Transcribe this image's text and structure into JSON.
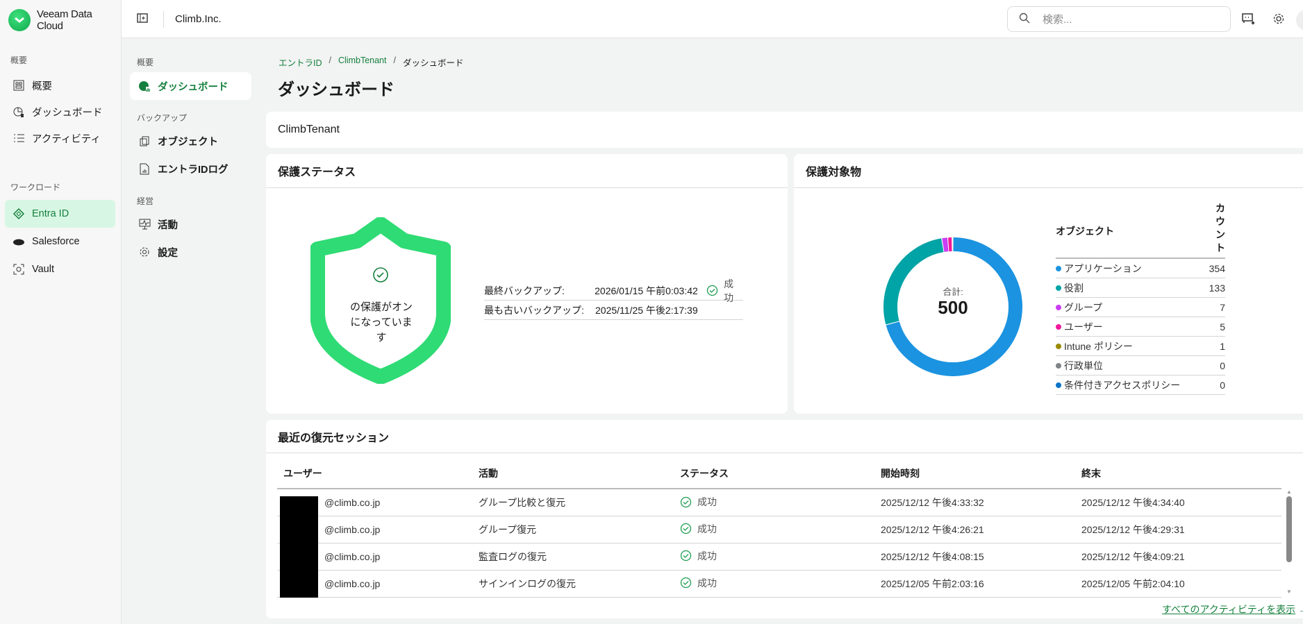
{
  "app": {
    "name": "Veeam Data Cloud",
    "org": "Climb.Inc."
  },
  "search": {
    "placeholder": "検索..."
  },
  "sidebar": {
    "section1": "概要",
    "items1": [
      {
        "label": "概要"
      },
      {
        "label": "ダッシュボード"
      },
      {
        "label": "アクティビティ"
      }
    ],
    "section2": "ワークロード",
    "items2": [
      {
        "label": "Entra ID"
      },
      {
        "label": "Salesforce"
      },
      {
        "label": "Vault"
      }
    ]
  },
  "subnav": {
    "s1": "概要",
    "dashboard": "ダッシュボード",
    "s2": "バックアップ",
    "objects": "オブジェクト",
    "entralog": "エントラIDログ",
    "s3": "経営",
    "activity": "活動",
    "settings": "設定"
  },
  "breadcrumb": [
    "エントラID",
    "ClimbTenant",
    "ダッシュボード"
  ],
  "page_title": "ダッシュボード",
  "tenant": "ClimbTenant",
  "protection": {
    "title": "保護ステータス",
    "shield_text": "の保護がオンになっています",
    "last_label": "最終バックアップ:",
    "last_value": "2026/01/15 午前0:03:42",
    "last_status": "成功",
    "oldest_label": "最も古いバックアップ:",
    "oldest_value": "2025/11/25 午後2:17:39"
  },
  "protected": {
    "title": "保護対象物",
    "total_label": "合計:",
    "total": "500",
    "col_object": "オブジェクト",
    "col_count": "カウント",
    "items": [
      {
        "label": "アプリケーション",
        "count": 354,
        "color": "#1b93e0"
      },
      {
        "label": "役割",
        "count": 133,
        "color": "#00a3a6"
      },
      {
        "label": "グループ",
        "count": 7,
        "color": "#c93df5"
      },
      {
        "label": "ユーザー",
        "count": 5,
        "color": "#f0189a"
      },
      {
        "label": "Intune ポリシー",
        "count": 1,
        "color": "#9a8a00"
      },
      {
        "label": "行政単位",
        "count": 0,
        "color": "#7f8487"
      },
      {
        "label": "条件付きアクセスポリシー",
        "count": 0,
        "color": "#0b74c9"
      }
    ]
  },
  "sessions": {
    "title": "最近の復元セッション",
    "headers": [
      "ユーザー",
      "活動",
      "ステータス",
      "開始時刻",
      "終末"
    ],
    "rows": [
      [
        "@climb.co.jp",
        "グループ比較と復元",
        "成功",
        "2025/12/12 午後4:33:32",
        "2025/12/12 午後4:34:40"
      ],
      [
        "@climb.co.jp",
        "グループ復元",
        "成功",
        "2025/12/12 午後4:26:21",
        "2025/12/12 午後4:29:31"
      ],
      [
        "@climb.co.jp",
        "監査ログの復元",
        "成功",
        "2025/12/12 午後4:08:15",
        "2025/12/12 午後4:09:21"
      ],
      [
        "@climb.co.jp",
        "サインインログの復元",
        "成功",
        "2025/12/05 午前2:03:16",
        "2025/12/05 午前2:04:10"
      ]
    ],
    "view_all": "すべてのアクティビティを表示"
  }
}
